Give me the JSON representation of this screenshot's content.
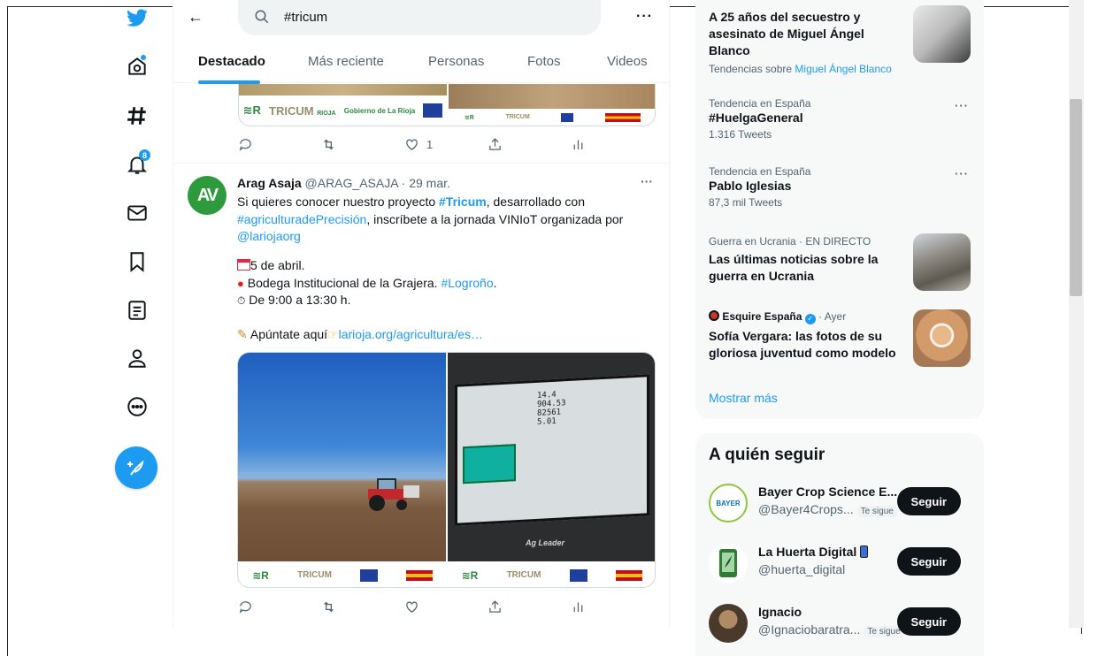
{
  "search": {
    "query": "#tricum"
  },
  "tabs": [
    {
      "label": "Destacado"
    },
    {
      "label": "Más reciente"
    },
    {
      "label": "Personas"
    },
    {
      "label": "Fotos"
    },
    {
      "label": "Videos"
    }
  ],
  "nav": {
    "notifications_badge": "8"
  },
  "tweet1": {
    "like_count": "1",
    "logos": [
      "RIOJA",
      "Gobierno de La Rioja"
    ]
  },
  "tweet2": {
    "author": "Arag Asaja",
    "handle": "@ARAG_ASAJA",
    "date": "· 29 mar.",
    "text_1": "Si quieres conocer nuestro proyecto ",
    "hashtag_1": "#Tricum",
    "text_2": ", desarrollado con",
    "hashtag_2": "#agriculturadePrecisión",
    "text_3": ", inscríbete a la jornada  VINIoT organizada por",
    "mention": "@lariojaorg",
    "date_line": "5 de abril.",
    "place_line": " Bodega Institucional de la Grajera. ",
    "place_tag": "#Logroño",
    "time_line": " De 9:00 a 13:30 h.",
    "signup_text": " Apúntate aquí",
    "signup_link": "larioja.org/agricultura/es…",
    "logo_text_1": "TRICUM",
    "logo_text_2": "Ag Leader"
  },
  "trends": [
    {
      "title": "A 25 años del secuestro y asesinato de Miguel Ángel Blanco",
      "meta_prefix": "Tendencias sobre ",
      "meta_link": "Miguel Ángel Blanco"
    },
    {
      "meta": "Tendencia en España",
      "title": "#HuelgaGeneral",
      "count": "1.316 Tweets"
    },
    {
      "meta": "Tendencia en España",
      "title": "Pablo Iglesias",
      "count": "87,3 mil Tweets"
    },
    {
      "meta": "Guerra en Ucrania · EN DIRECTO",
      "title": "Las últimas noticias sobre la guerra en Ucrania"
    },
    {
      "meta_source": "Esquire España",
      "meta_time": "· Ayer",
      "title": "Sofía Vergara: las fotos de su gloriosa juventud como modelo"
    }
  ],
  "show_more": "Mostrar más",
  "who_to_follow": {
    "title": "A quién seguir",
    "accounts": [
      {
        "name": "Bayer Crop Science E...",
        "handle": "@Bayer4Crops...",
        "tag": "Te sigue",
        "button": "Seguir"
      },
      {
        "name": "La Huerta Digital",
        "handle": "@huerta_digital",
        "button": "Seguir"
      },
      {
        "name": "Ignacio",
        "handle": "@Ignaciobaratra...",
        "tag": "Te sigue",
        "button": "Seguir"
      }
    ]
  },
  "colors": {
    "accent": "#1d9bf0",
    "text": "#0f1419",
    "muted": "#536471"
  }
}
